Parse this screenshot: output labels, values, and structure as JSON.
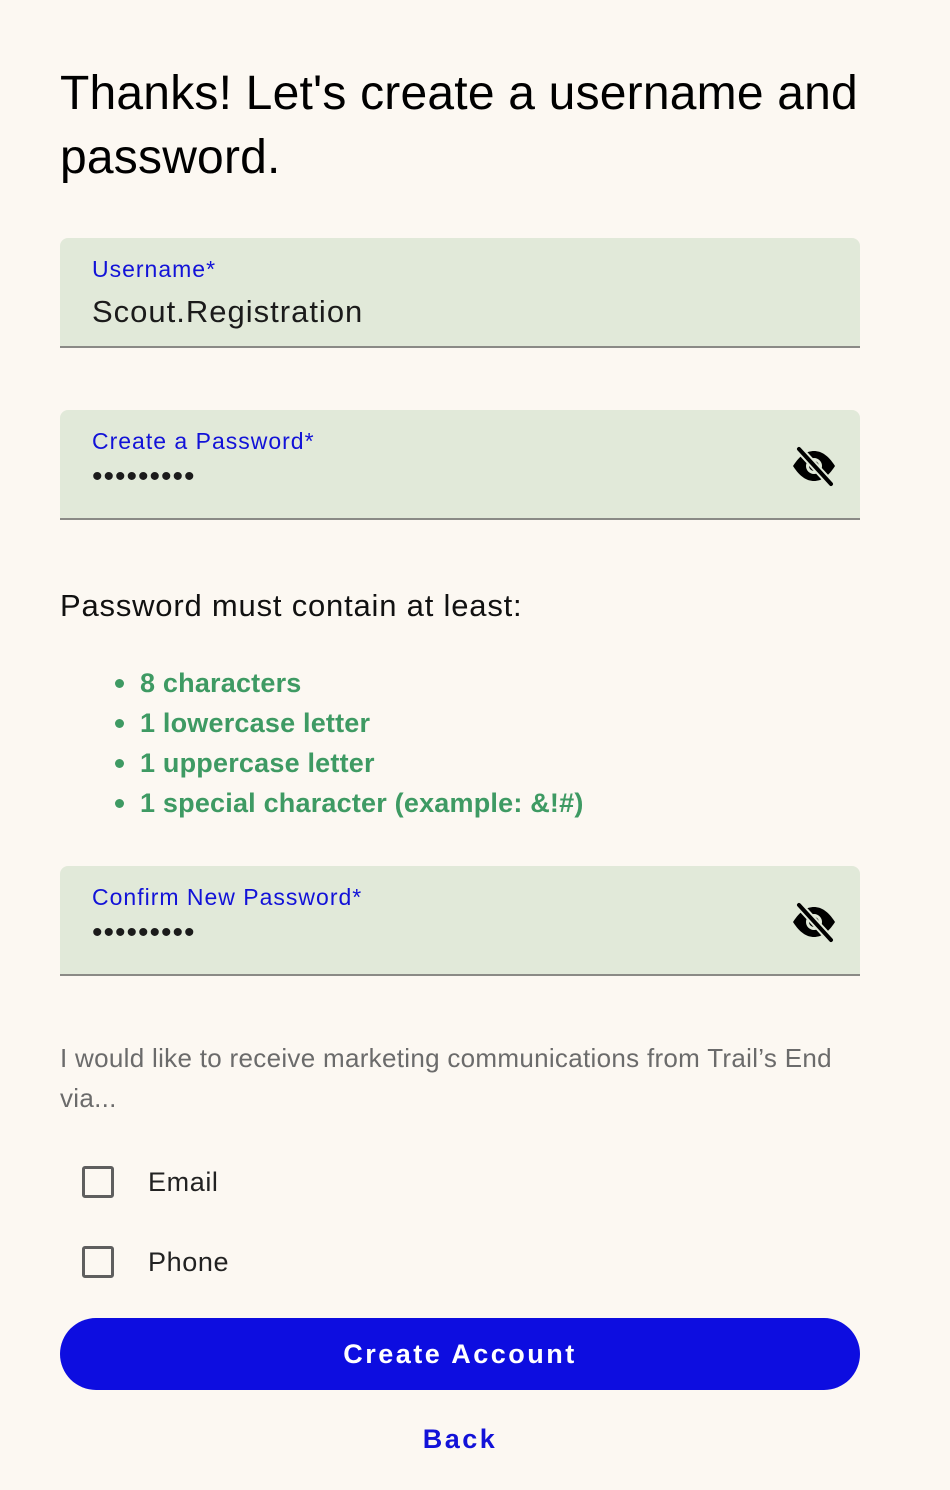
{
  "page": {
    "title": "Thanks! Let's create a username and password."
  },
  "username_field": {
    "label": "Username*",
    "value": "Scout.Registration"
  },
  "password_field": {
    "label": "Create a Password*",
    "value": "•••••••••",
    "visibility_icon": "eye-off-icon"
  },
  "password_rules": {
    "heading": "Password must contain at least:",
    "items": [
      "8 characters",
      "1 lowercase letter",
      "1 uppercase letter",
      "1 special character (example: &!#)"
    ],
    "color": "#3e9a63"
  },
  "confirm_field": {
    "label": "Confirm New Password*",
    "value": "•••••••••",
    "visibility_icon": "eye-off-icon"
  },
  "marketing": {
    "text": "I would like to receive marketing communications from Trail’s End via...",
    "options": [
      {
        "label": "Email",
        "checked": false
      },
      {
        "label": "Phone",
        "checked": false
      }
    ]
  },
  "actions": {
    "create_account_label": "Create Account",
    "back_label": "Back"
  },
  "colors": {
    "background": "#fcf8f2",
    "field_background": "#e1e9d9",
    "accent": "#0d0de0",
    "label": "#1212d8"
  }
}
